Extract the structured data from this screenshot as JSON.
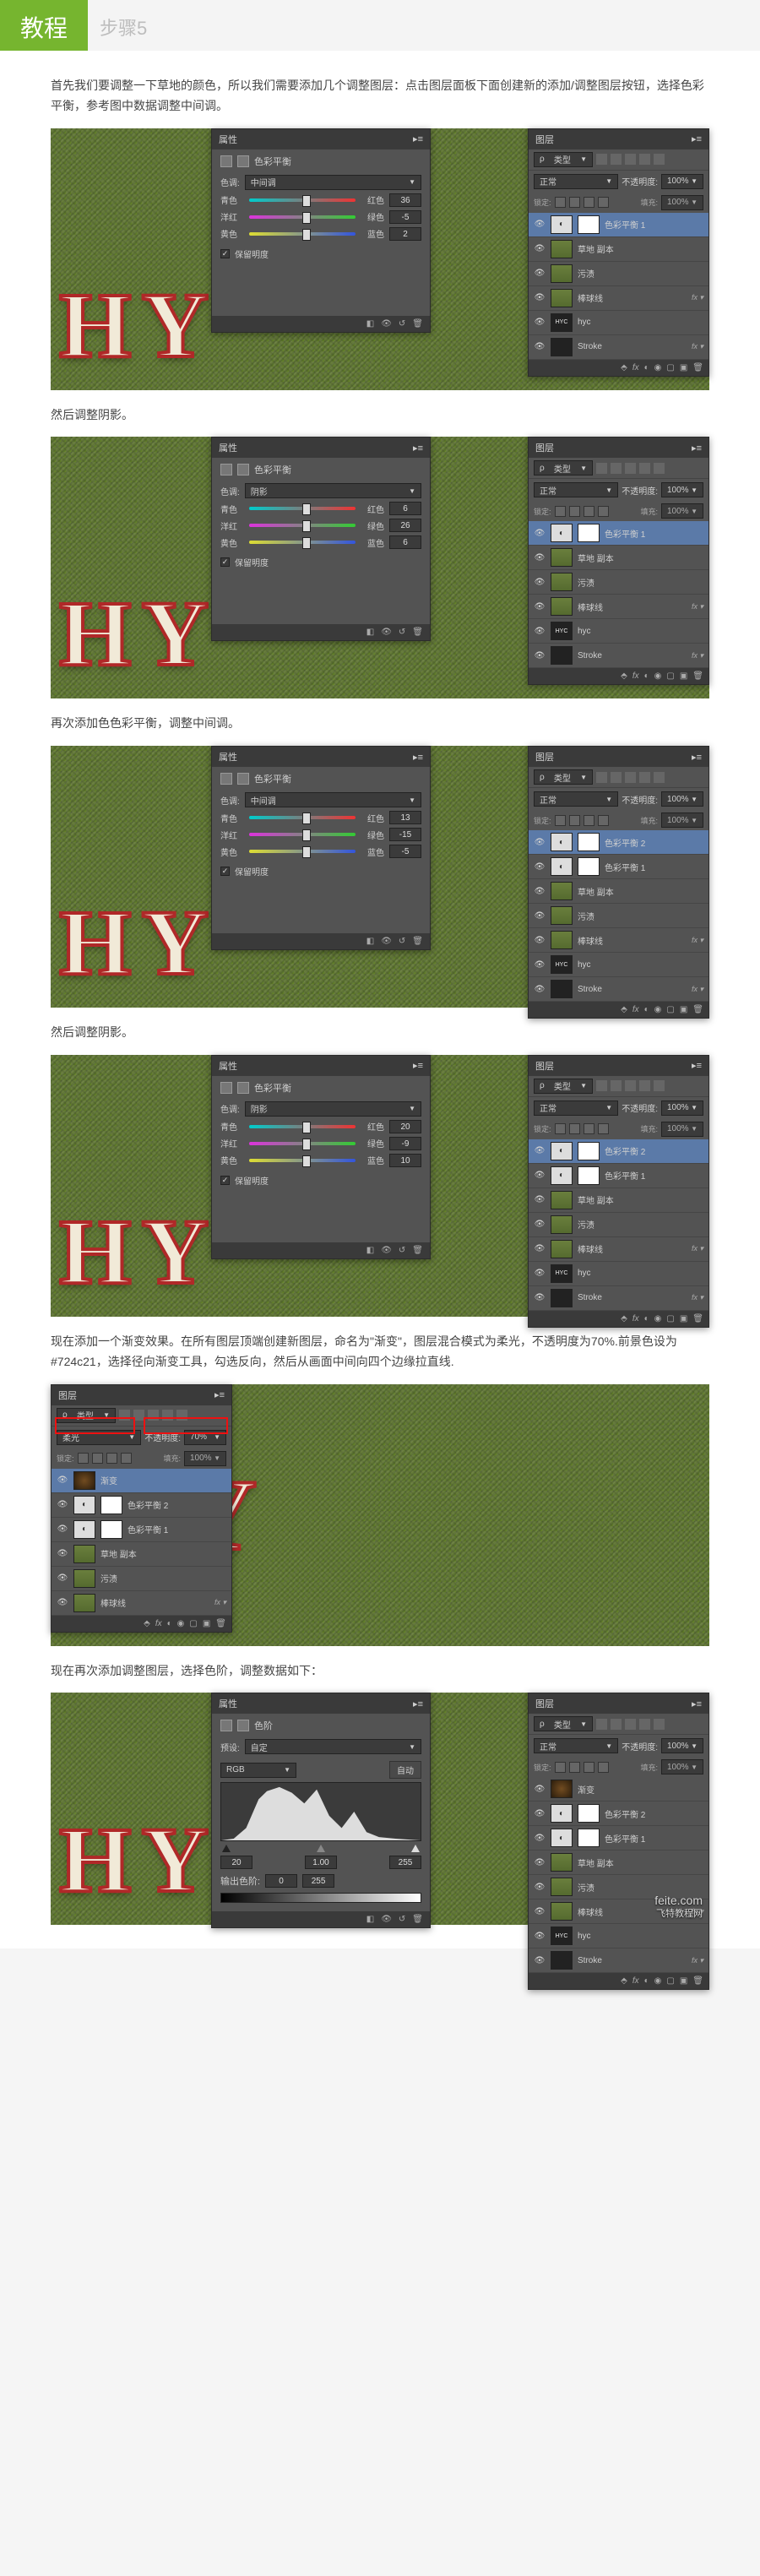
{
  "header": {
    "title": "教程",
    "subtitle": "步骤5"
  },
  "intro": "首先我们要调整一下草地的颜色，所以我们需要添加几个调整图层：点击图层面板下面创建新的添加/调整图层按钮，选择色彩平衡，参考图中数据调整中间调。",
  "panel_labels": {
    "props": "属性",
    "title": "色彩平衡",
    "tone_label": "色调:",
    "cyan": "青色",
    "red": "红色",
    "magenta": "洋红",
    "green": "绿色",
    "yellow": "黄色",
    "blue": "蓝色",
    "preserve": "保留明度",
    "layers_tab": "图层",
    "type_dd": "类型",
    "opacity": "不透明度:",
    "pct100": "100%",
    "pct70": "70%",
    "lock": "锁定:",
    "fill": "填充:",
    "levels_title": "色阶",
    "preset": "预设:",
    "custom": "自定",
    "rgb": "RGB",
    "auto": "自动",
    "output": "输出色阶:"
  },
  "blend": {
    "normal": "正常",
    "soft_light": "柔光"
  },
  "tone": {
    "mid": "中间调",
    "shadow": "阴影"
  },
  "layers": {
    "cb1": "色彩平衡 1",
    "cb2": "色彩平衡 2",
    "grass": "草地 副本",
    "dirt": "污渍",
    "stitch": "棒球线",
    "hyc": "hyc",
    "stroke": "Stroke",
    "grad": "渐变"
  },
  "steps": [
    {
      "text_after": "然后调整阴影。",
      "tone": "mid",
      "vals": [
        "36",
        "-5",
        "2"
      ],
      "layer_stack": [
        "cb1",
        "grass",
        "dirt",
        "stitch",
        "hyc",
        "stroke"
      ],
      "sel_idx": 0,
      "blend": "normal",
      "op": "pct100"
    },
    {
      "text_after": "再次添加色色彩平衡，调整中间调。",
      "tone": "shadow",
      "vals": [
        "6",
        "26",
        "6"
      ],
      "layer_stack": [
        "cb1",
        "grass",
        "dirt",
        "stitch",
        "hyc",
        "stroke"
      ],
      "sel_idx": 0,
      "blend": "normal",
      "op": "pct100"
    },
    {
      "text_after": "然后调整阴影。",
      "tone": "mid",
      "vals": [
        "13",
        "-15",
        "-5"
      ],
      "layer_stack": [
        "cb2",
        "cb1",
        "grass",
        "dirt",
        "stitch",
        "hyc",
        "stroke"
      ],
      "sel_idx": 0,
      "blend": "normal",
      "op": "pct100"
    },
    {
      "text_after": "现在添加一个渐变效果。在所有图层顶端创建新图层，命名为\"渐变\"，图层混合模式为柔光，不透明度为70%.前景色设为#724c21，选择径向渐变工具，勾选反向，然后从画面中间向四个边缘拉直线.",
      "tone": "shadow",
      "vals": [
        "20",
        "-9",
        "10"
      ],
      "layer_stack": [
        "cb2",
        "cb1",
        "grass",
        "dirt",
        "stitch",
        "hyc",
        "stroke"
      ],
      "sel_idx": 0,
      "blend": "normal",
      "op": "pct100"
    },
    {
      "text_after": "现在再次添加调整图层，选择色阶，调整数据如下：",
      "letters_full": true,
      "layer_stack": [
        "grad",
        "cb2",
        "cb1",
        "grass",
        "dirt",
        "stitch"
      ],
      "sel_idx": 0,
      "blend": "soft_light",
      "op": "pct70",
      "highlight": true
    }
  ],
  "levels": {
    "inputs": [
      "20",
      "1.00",
      "255"
    ],
    "outputs": [
      "0",
      "255"
    ],
    "layer_stack": [
      "grad",
      "cb2",
      "cb1",
      "grass",
      "dirt",
      "stitch",
      "hyc",
      "stroke"
    ]
  },
  "watermark": {
    "brand": "feite.com",
    "site": "飞特教程网"
  }
}
